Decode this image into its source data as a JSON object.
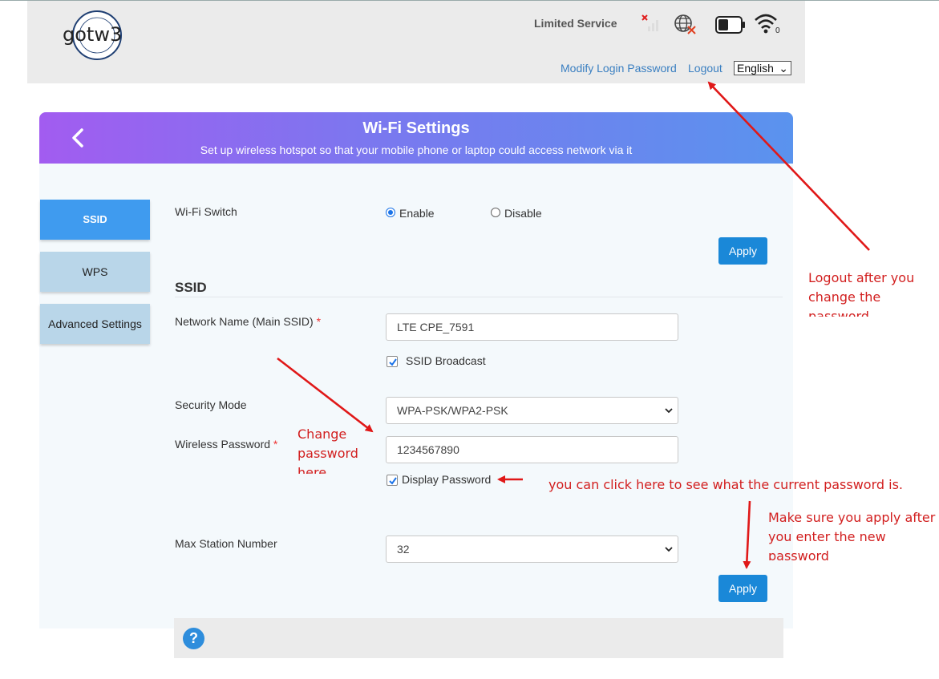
{
  "header": {
    "logo_text": "gotw3",
    "status": "Limited Service",
    "modify_password_link": "Modify Login Password",
    "logout_link": "Logout",
    "language": "English",
    "icons": [
      "logo",
      "signal-no-service-icon",
      "globe-disconnected-icon",
      "battery-icon",
      "wifi-clients-icon"
    ],
    "wifi_client_count": "0"
  },
  "banner": {
    "title": "Wi-Fi Settings",
    "subtitle": "Set up wireless hotspot so that your mobile phone or laptop could access network via it"
  },
  "sidebar": {
    "items": [
      {
        "label": "SSID",
        "active": true
      },
      {
        "label": "WPS",
        "active": false
      },
      {
        "label": "Advanced Settings",
        "active": false
      }
    ]
  },
  "wifi_switch": {
    "label": "Wi-Fi Switch",
    "options": [
      "Enable",
      "Disable"
    ],
    "selected": "Enable",
    "apply_label": "Apply"
  },
  "ssid": {
    "section_title": "SSID",
    "network_name_label": "Network Name (Main SSID)",
    "required_mark": "*",
    "network_name_value": "LTE CPE_7591",
    "broadcast_label": "SSID Broadcast",
    "broadcast_checked": true,
    "security_mode_label": "Security Mode",
    "security_mode_value": "WPA-PSK/WPA2-PSK",
    "password_label": "Wireless Password",
    "password_value": "1234567890",
    "display_password_label": "Display Password",
    "display_password_checked": true,
    "max_station_label": "Max Station Number",
    "max_station_value": "32",
    "apply_label": "Apply"
  },
  "help": {
    "icon": "question-icon",
    "glyph": "?"
  },
  "annotations": {
    "logout_note": "Logout after you change the password",
    "change_note": "Change password here",
    "display_note": "you can click here to see what the current password is.",
    "apply_note": "Make sure you apply after you enter the new password",
    "color": "#d21f1f"
  },
  "colors": {
    "accent": "#1a88d8",
    "sidebar_active": "#3f9bef",
    "sidebar_inactive": "#b9d6e9",
    "banner_gradient": [
      "#a25cf0",
      "#5a93ee"
    ]
  }
}
